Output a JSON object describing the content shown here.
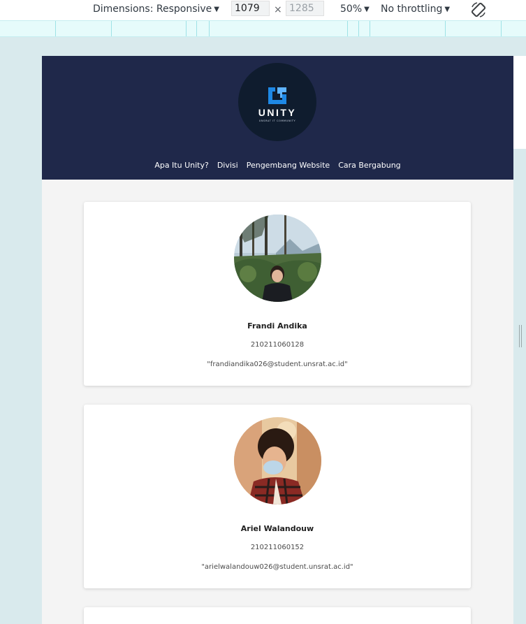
{
  "devtools": {
    "dimensions_label": "Dimensions: Responsive",
    "width_value": "1079",
    "height_placeholder": "1285",
    "times_symbol": "×",
    "zoom_label": "50%",
    "throttling_label": "No throttling",
    "icons": [
      "chevron-down-icon",
      "rotate-icon"
    ]
  },
  "header": {
    "logo_text": "UNITY",
    "logo_subtext": "UNSRAT IT COMMUNITY",
    "nav_items": [
      {
        "label": "Apa Itu Unity?"
      },
      {
        "label": "Divisi"
      },
      {
        "label": "Pengembang Website"
      },
      {
        "label": "Cara Bergabung"
      }
    ]
  },
  "members": [
    {
      "name": "Frandi Andika",
      "nim": "210211060128",
      "email": "\"frandiandika026@student.unsrat.ac.id\""
    },
    {
      "name": "Ariel Walandouw",
      "nim": "210211060152",
      "email": "\"arielwalandouw026@student.unsrat.ac.id\""
    }
  ],
  "colors": {
    "header_bg": "#1f284a",
    "page_bg": "#f4f4f4",
    "card_bg": "#ffffff",
    "devtools_bg": "#d9eaed"
  }
}
